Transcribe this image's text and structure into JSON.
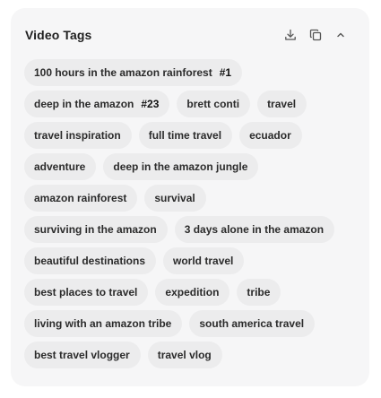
{
  "panel": {
    "title": "Video Tags",
    "icons": {
      "download": "download-icon",
      "copy": "copy-icon",
      "collapse": "chevron-up-icon"
    }
  },
  "rows": [
    [
      {
        "label": "100 hours in the amazon rainforest",
        "rank": "#1"
      }
    ],
    [
      {
        "label": "deep in the amazon",
        "rank": "#23"
      },
      {
        "label": "brett conti"
      },
      {
        "label": "travel"
      }
    ],
    [
      {
        "label": "travel inspiration"
      },
      {
        "label": "full time travel"
      },
      {
        "label": "ecuador"
      }
    ],
    [
      {
        "label": "adventure"
      },
      {
        "label": "deep in the amazon jungle"
      }
    ],
    [
      {
        "label": "amazon rainforest"
      },
      {
        "label": "survival"
      }
    ],
    [
      {
        "label": "surviving in the amazon"
      },
      {
        "label": "3 days alone in the amazon"
      }
    ],
    [
      {
        "label": "beautiful destinations"
      },
      {
        "label": "world travel"
      }
    ],
    [
      {
        "label": "best places to travel"
      },
      {
        "label": "expedition"
      },
      {
        "label": "tribe"
      }
    ],
    [
      {
        "label": "living with an amazon tribe"
      },
      {
        "label": "south america travel"
      }
    ],
    [
      {
        "label": "best travel vlogger"
      },
      {
        "label": "travel vlog"
      }
    ]
  ]
}
